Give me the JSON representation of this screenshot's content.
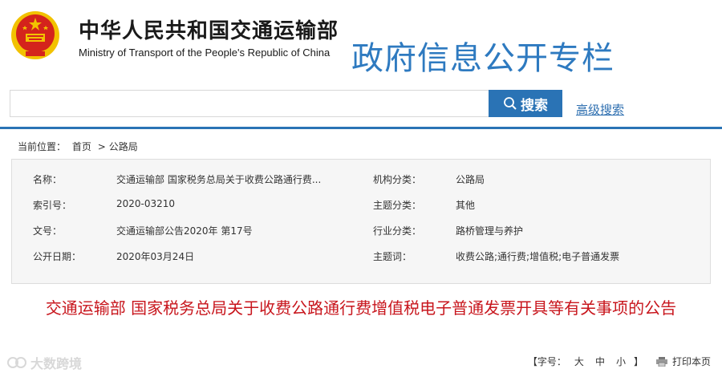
{
  "header": {
    "emblem_icon": "national-emblem-icon",
    "ministry_cn": "中华人民共和国交通运输部",
    "ministry_en": "Ministry of Transport of the People's Republic of China",
    "column_title": "政府信息公开专栏",
    "colors": {
      "brand_blue": "#2e7ac0",
      "emblem_red": "#d4231c",
      "emblem_gold": "#f2c200"
    }
  },
  "search": {
    "value": "",
    "placeholder": "",
    "button_label": "搜索",
    "button_icon": "search-icon",
    "advanced_label": "高级搜索",
    "button_color": "#2a73b5"
  },
  "breadcrumb": {
    "prefix": "当前位置：",
    "home": "首页",
    "separator": ">",
    "current": "公路局"
  },
  "meta": {
    "rows": [
      {
        "label1": "名称：",
        "value1": "交通运输部 国家税务总局关于收费公路通行费...",
        "label2": "机构分类：",
        "value2": "公路局"
      },
      {
        "label1": "索引号：",
        "value1": "2020-03210",
        "label2": "主题分类：",
        "value2": "其他"
      },
      {
        "label1": "文号：",
        "value1": "交通运输部公告2020年 第17号",
        "label2": "行业分类：",
        "value2": "路桥管理与养护"
      },
      {
        "label1": "公开日期：",
        "value1": "2020年03月24日",
        "label2": "主题词：",
        "value2": "收费公路;通行费;增值税;电子普通发票"
      }
    ]
  },
  "document": {
    "title": "交通运输部 国家税务总局关于收费公路通行费增值税电子普通发票开具等有关事项的公告",
    "title_color": "#c8161d"
  },
  "watermark": {
    "text": "大数跨境",
    "logo_icon": "watermark-logo-icon"
  },
  "footer": {
    "font_size_label": "【字号：",
    "size_large": "大",
    "size_medium": "中",
    "size_small": "小",
    "close_bracket": "】",
    "print_icon": "print-icon",
    "print_label": "打印本页"
  }
}
